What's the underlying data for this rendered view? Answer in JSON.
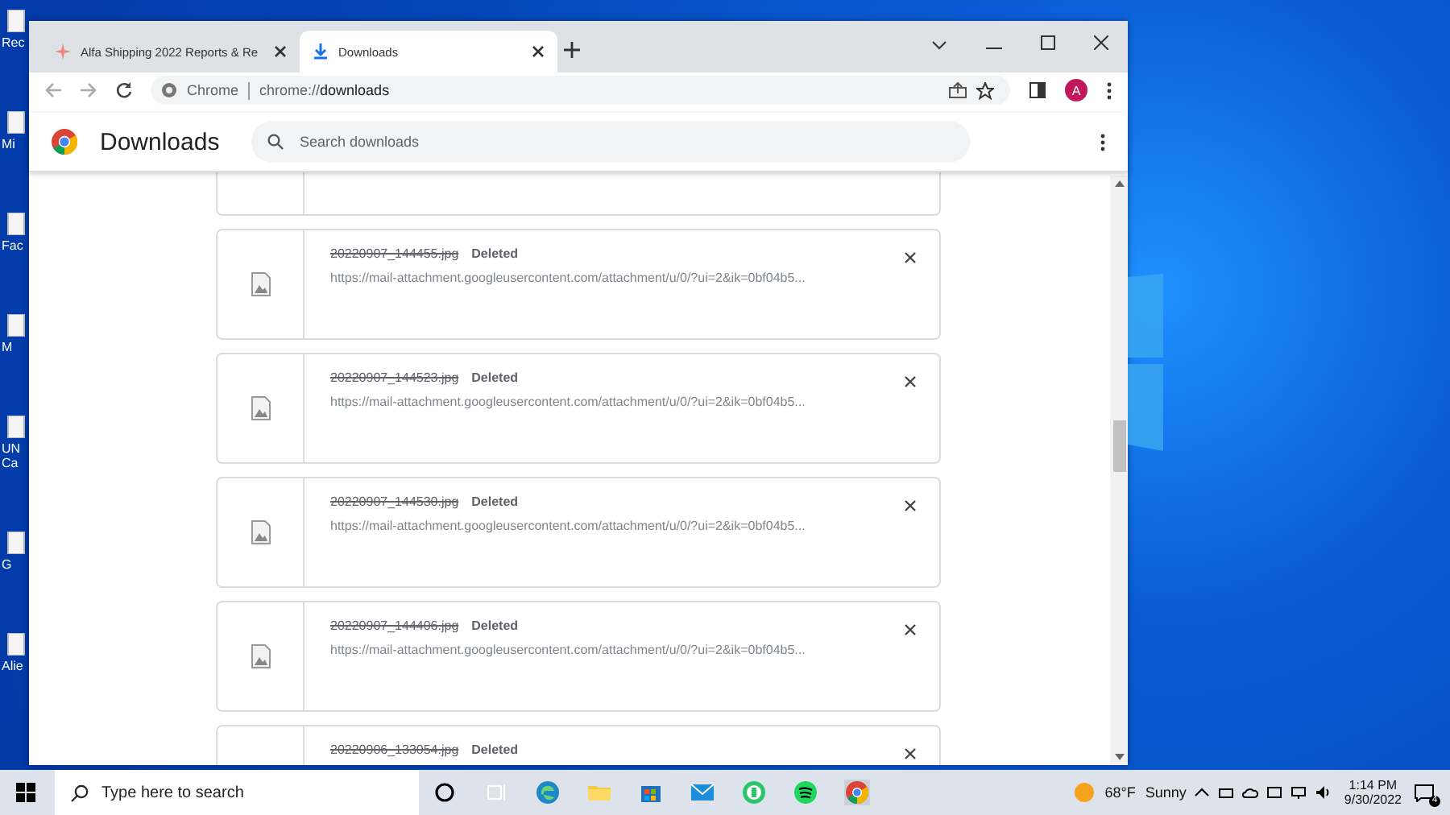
{
  "desktop_icons": [
    {
      "label": "Rec"
    },
    {
      "label": "Mi"
    },
    {
      "label": "Fac"
    },
    {
      "label": "M"
    },
    {
      "label": "UN Ca"
    },
    {
      "label": "G"
    },
    {
      "label": "Alie"
    }
  ],
  "window": {
    "tabs": [
      {
        "title": "Alfa Shipping 2022 Reports & Re",
        "selected": false
      },
      {
        "title": "Downloads",
        "selected": true
      }
    ],
    "address": {
      "site_label": "Chrome",
      "url_scheme": "chrome://",
      "url_path": "downloads"
    },
    "profile_initial": "A"
  },
  "page": {
    "title": "Downloads",
    "search": {
      "placeholder": "Search downloads"
    },
    "downloads": [
      {
        "file": "20220907_144455.jpg",
        "status": "Deleted",
        "deleted": true,
        "url": "https://mail-attachment.googleusercontent.com/attachment/u/0/?ui=2&ik=0bf04b5..."
      },
      {
        "file": "20220907_144523.jpg",
        "status": "Deleted",
        "deleted": true,
        "url": "https://mail-attachment.googleusercontent.com/attachment/u/0/?ui=2&ik=0bf04b5..."
      },
      {
        "file": "20220907_144530.jpg",
        "status": "Deleted",
        "deleted": true,
        "url": "https://mail-attachment.googleusercontent.com/attachment/u/0/?ui=2&ik=0bf04b5..."
      },
      {
        "file": "20220907_144406.jpg",
        "status": "Deleted",
        "deleted": true,
        "url": "https://mail-attachment.googleusercontent.com/attachment/u/0/?ui=2&ik=0bf04b5..."
      },
      {
        "file": "20220906_133054.jpg",
        "status": "Deleted",
        "deleted": true
      }
    ]
  },
  "taskbar": {
    "search_placeholder": "Type here to search",
    "weather": {
      "temp": "68°F",
      "condition": "Sunny"
    },
    "time": "1:14 PM",
    "date": "9/30/2022",
    "notifications": "4"
  }
}
